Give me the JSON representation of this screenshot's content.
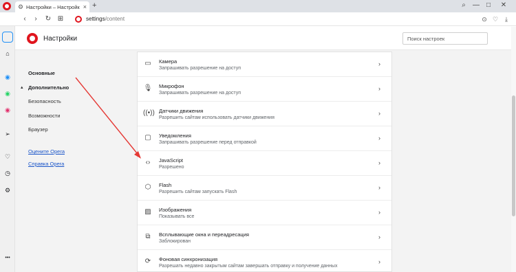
{
  "tab": {
    "title": "Настройки – Настройки о",
    "close_glyph": "×",
    "gear_glyph": "⚙"
  },
  "new_tab_glyph": "+",
  "window_controls": {
    "search": "⌕",
    "minimize": "—",
    "maximize": "□",
    "close": "✕"
  },
  "nav": {
    "back": "‹",
    "forward": "›",
    "reload": "↻",
    "tabs": "⊞"
  },
  "address": {
    "host": "settings",
    "path": "/content"
  },
  "toolbar": {
    "camera": "⊙",
    "heart": "♡",
    "download": "⤓"
  },
  "sidebar_icons": [
    {
      "name": "home-icon",
      "glyph": "⌂",
      "color": "#555555"
    },
    {
      "name": "messenger-icon",
      "glyph": "◉",
      "color": "#1d8ff7"
    },
    {
      "name": "whatsapp-icon",
      "glyph": "◉",
      "color": "#25d366"
    },
    {
      "name": "instagram-icon",
      "glyph": "◉",
      "color": "#e1306c"
    },
    {
      "name": "send-icon",
      "glyph": "➢",
      "color": "#555555"
    },
    {
      "name": "heart-icon",
      "glyph": "♡",
      "color": "#555555"
    },
    {
      "name": "history-icon",
      "glyph": "◷",
      "color": "#555555"
    },
    {
      "name": "settings-icon",
      "glyph": "⚙",
      "color": "#555555"
    },
    {
      "name": "more-icon",
      "glyph": "•••",
      "color": "#555555"
    }
  ],
  "settings": {
    "title": "Настройки",
    "search_placeholder": "Поиск настроек"
  },
  "left_nav": {
    "basic": "Основные",
    "advanced_toggle": "▴",
    "advanced": "Дополнительно",
    "security": "Безопасность",
    "features": "Возможности",
    "browser": "Браузер",
    "rate_opera": "Оцените Opera",
    "help_opera": "Справка Opera"
  },
  "content_rows": [
    {
      "name": "camera",
      "icon": "camera-icon",
      "glyph": "▭",
      "title": "Камера",
      "subtitle": "Запрашивать разрешение на доступ"
    },
    {
      "name": "microphone",
      "icon": "microphone-icon",
      "glyph": "🎙",
      "title": "Микрофон",
      "subtitle": "Запрашивать разрешение на доступ"
    },
    {
      "name": "motion-sensors",
      "icon": "sensors-icon",
      "glyph": "((•))",
      "title": "Датчики движения",
      "subtitle": "Разрешить сайтам использовать датчики движения"
    },
    {
      "name": "notifications",
      "icon": "notification-icon",
      "glyph": "▢",
      "title": "Уведомления",
      "subtitle": "Запрашивать разрешение перед отправкой"
    },
    {
      "name": "javascript",
      "icon": "code-icon",
      "glyph": "‹›",
      "title": "JavaScript",
      "subtitle": "Разрешено"
    },
    {
      "name": "flash",
      "icon": "puzzle-icon",
      "glyph": "⬡",
      "title": "Flash",
      "subtitle": "Разрешить сайтам запускать Flash"
    },
    {
      "name": "images",
      "icon": "image-icon",
      "glyph": "▨",
      "title": "Изображения",
      "subtitle": "Показывать все"
    },
    {
      "name": "popups",
      "icon": "popup-icon",
      "glyph": "⧉",
      "title": "Всплывающие окна и переадресация",
      "subtitle": "Заблокирован"
    },
    {
      "name": "background-sync",
      "icon": "sync-icon",
      "glyph": "⟳",
      "title": "Фоновая синхронизация",
      "subtitle": "Разрешать недавно закрытым сайтам завершать отправку и получение данных"
    }
  ],
  "row_arrow": "›",
  "colors": {
    "opera_red": "#e0151e",
    "annotation_arrow": "#e53935",
    "link": "#1a55c9"
  }
}
